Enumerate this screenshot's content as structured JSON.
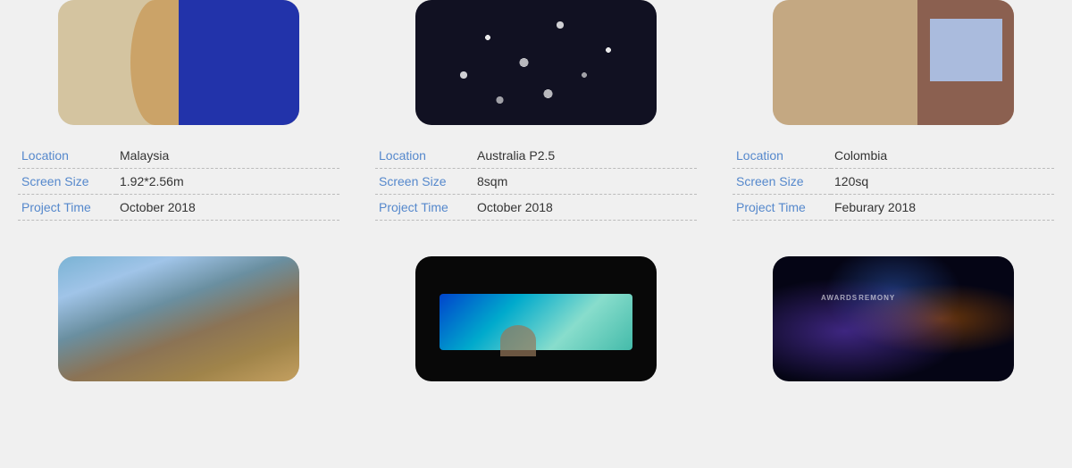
{
  "cards": [
    {
      "id": "malaysia",
      "location_label": "Location",
      "location_value": "Malaysia",
      "screen_label": "Screen Size",
      "screen_value": "1.92*2.56m",
      "time_label": "Project Time",
      "time_value": "October 2018"
    },
    {
      "id": "australia",
      "location_label": "Location",
      "location_value": "Australia P2.5",
      "screen_label": "Screen Size",
      "screen_value": "8sqm",
      "time_label": "Project Time",
      "time_value": "October 2018"
    },
    {
      "id": "colombia",
      "location_label": "Location",
      "location_value": "Colombia",
      "screen_label": "Screen Size",
      "screen_value": "120sq",
      "time_label": "Project Time",
      "time_value": "Feburary 2018"
    }
  ],
  "bottom_cards": [
    {
      "id": "stairs",
      "image_type": "stairs"
    },
    {
      "id": "theater",
      "image_type": "theater"
    },
    {
      "id": "awards",
      "image_type": "awards"
    }
  ]
}
